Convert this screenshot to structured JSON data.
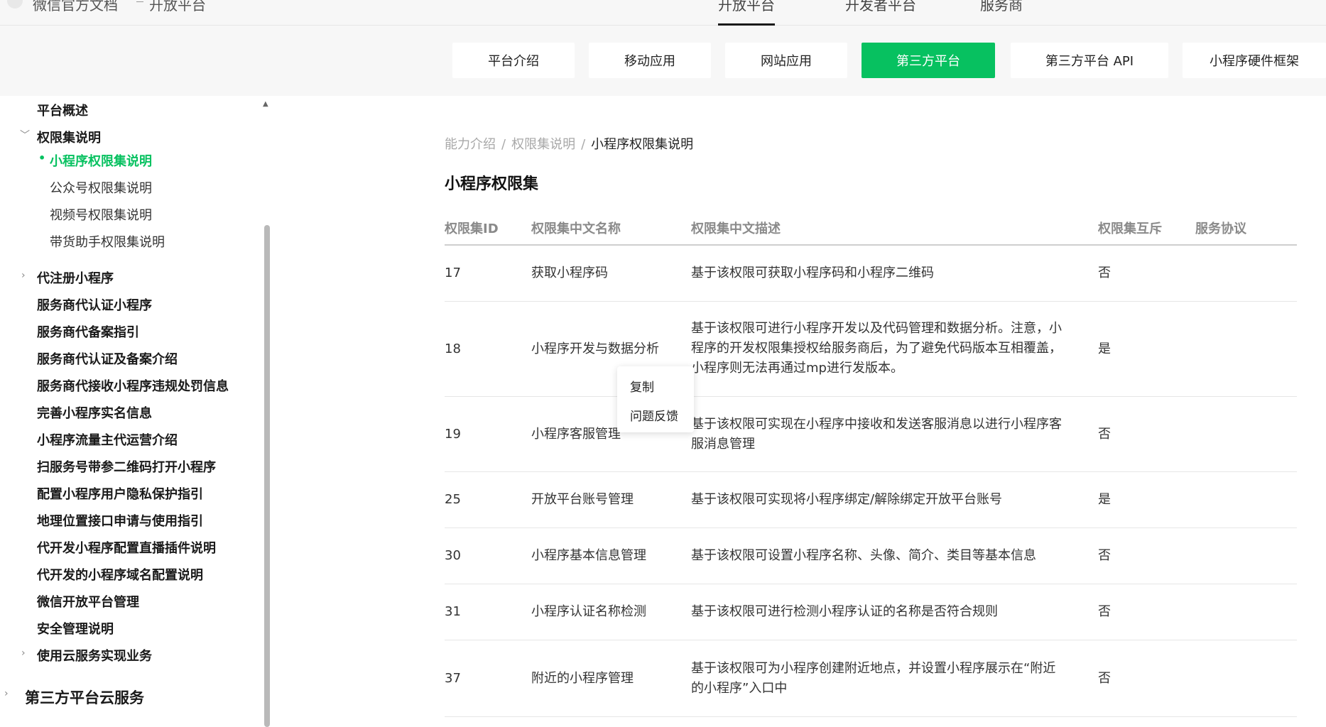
{
  "topbar": {
    "brand": "微信官方文档",
    "brand_sub": "开放平台",
    "nav": [
      "开放平台",
      "开发者平台",
      "服务商"
    ]
  },
  "categories": [
    "平台介绍",
    "移动应用",
    "网站应用",
    "第三方平台",
    "第三方平台 API",
    "小程序硬件框架"
  ],
  "active_category": "第三方平台",
  "sidebar": {
    "top_item": "平台概述",
    "group": "权限集说明",
    "subitems": [
      "小程序权限集说明",
      "公众号权限集说明",
      "视频号权限集说明",
      "带货助手权限集说明"
    ],
    "active_subitem": "小程序权限集说明",
    "items": [
      "代注册小程序",
      "服务商代认证小程序",
      "服务商代备案指引",
      "服务商代认证及备案介绍",
      "服务商代接收小程序违规处罚信息",
      "完善小程序实名信息",
      "小程序流量主代运营介绍",
      "扫服务号带参二维码打开小程序",
      "配置小程序用户隐私保护指引",
      "地理位置接口申请与使用指引",
      "代开发小程序配置直播插件说明",
      "代开发的小程序域名配置说明",
      "微信开放平台管理",
      "安全管理说明",
      "使用云服务实现业务"
    ],
    "bottom_section": "第三方平台云服务"
  },
  "breadcrumb": [
    "能力介绍",
    "权限集说明",
    "小程序权限集说明"
  ],
  "page_title": "小程序权限集",
  "table": {
    "headers": [
      "权限集ID",
      "权限集中文名称",
      "权限集中文描述",
      "权限集互斥",
      "服务协议"
    ],
    "rows": [
      {
        "id": "17",
        "name": "获取小程序码",
        "desc": "基于该权限可获取小程序码和小程序二维码",
        "mutex": "否"
      },
      {
        "id": "18",
        "name": "小程序开发与数据分析",
        "desc": "基于该权限可进行小程序开发以及代码管理和数据分析。注意，小程序的开发权限集授权给服务商后，为了避免代码版本互相覆盖，小程序则无法再通过mp进行发版本。",
        "mutex": "是"
      },
      {
        "id": "19",
        "name": "小程序客服管理",
        "desc": "基于该权限可实现在小程序中接收和发送客服消息以进行小程序客服消息管理",
        "mutex": "否"
      },
      {
        "id": "25",
        "name": "开放平台账号管理",
        "desc": "基于该权限可实现将小程序绑定/解除绑定开放平台账号",
        "mutex": "是"
      },
      {
        "id": "30",
        "name": "小程序基本信息管理",
        "desc": "基于该权限可设置小程序名称、头像、简介、类目等基本信息",
        "mutex": "否"
      },
      {
        "id": "31",
        "name": "小程序认证名称检测",
        "desc": "基于该权限可进行检测小程序认证的名称是否符合规则",
        "mutex": "否"
      },
      {
        "id": "37",
        "name": "附近的小程序管理",
        "desc": "基于该权限可为小程序创建附近地点，并设置小程序展示在“附近的小程序”入口中",
        "mutex": "否"
      }
    ]
  },
  "context_menu": [
    "复制",
    "问题反馈"
  ],
  "colors": {
    "accent": "#07c160",
    "topbar_bg": "#f7f7f7"
  }
}
